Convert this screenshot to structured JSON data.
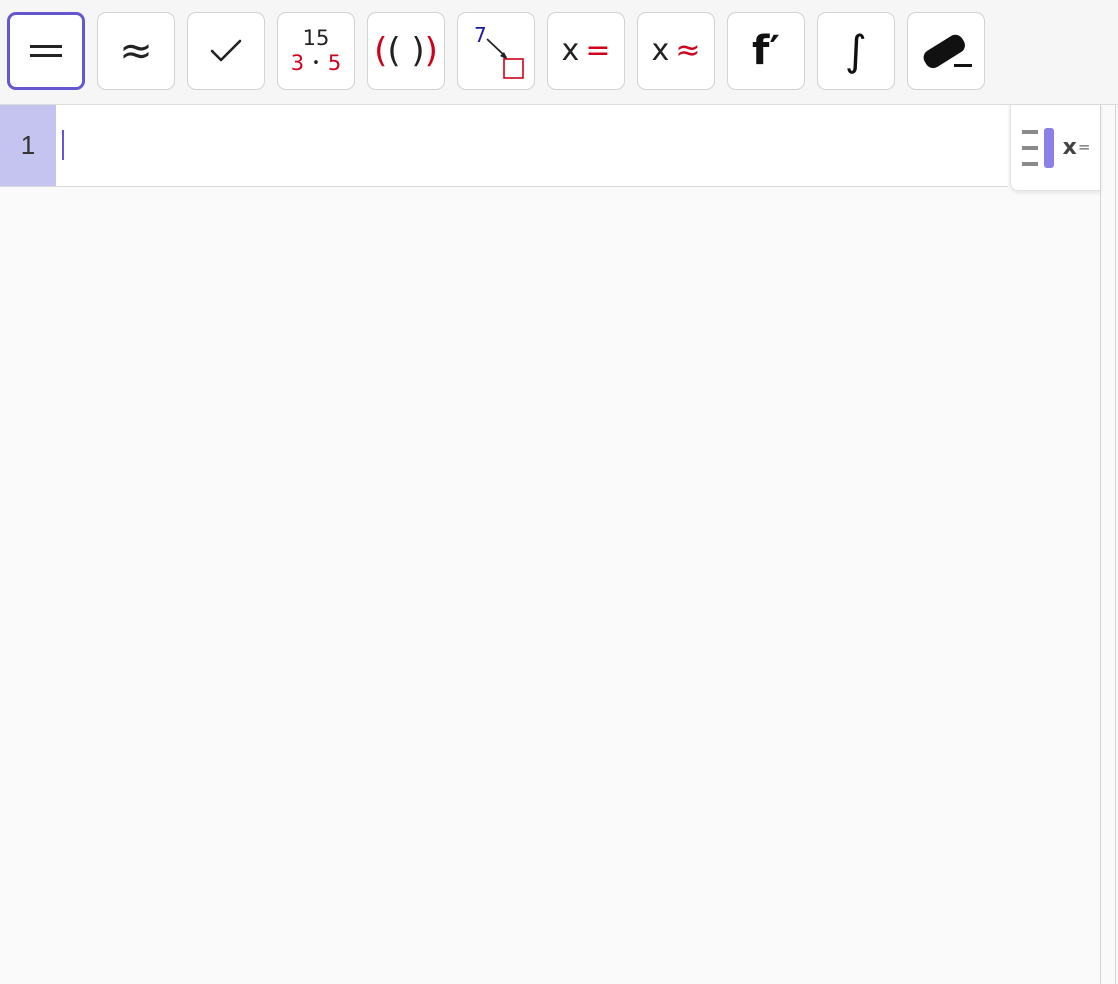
{
  "toolbar": {
    "tools": [
      {
        "id": "exact",
        "label": "=",
        "icon": "equals-icon",
        "selected": true
      },
      {
        "id": "numeric",
        "label": "≈",
        "icon": "approx-icon",
        "selected": false
      },
      {
        "id": "keep-input",
        "label": "✓",
        "icon": "check-icon",
        "selected": false
      },
      {
        "id": "factor",
        "top": "15",
        "bottom_left": "3",
        "dot": "•",
        "bottom_right": "5",
        "icon": "factor-icon",
        "selected": false
      },
      {
        "id": "expand",
        "outer_left": "(",
        "inner": "( )",
        "outer_right": ")",
        "icon": "expand-icon",
        "selected": false
      },
      {
        "id": "substitute",
        "label": "7",
        "icon": "substitute-icon",
        "selected": false
      },
      {
        "id": "solve",
        "x": "x",
        "op": "=",
        "icon": "solve-icon",
        "selected": false
      },
      {
        "id": "solve-numerically",
        "x": "x",
        "op": "≈",
        "icon": "solve-numerically-icon",
        "selected": false
      },
      {
        "id": "derivative",
        "label": "f′",
        "icon": "derivative-icon",
        "selected": false
      },
      {
        "id": "integral",
        "label": "∫",
        "icon": "integral-icon",
        "selected": false
      },
      {
        "id": "delete",
        "icon": "eraser-icon",
        "selected": false
      }
    ]
  },
  "algebra": {
    "rows": [
      {
        "number": "1",
        "value": ""
      }
    ]
  },
  "side_toggle": {
    "x_label": "x",
    "eq_label": "=",
    "icon": "keyboard-toggle-icon"
  },
  "colors": {
    "accent": "#6557d2",
    "red": "#d0021b",
    "blue": "#1a1aa8",
    "row_number_bg": "#c5c3ef"
  }
}
